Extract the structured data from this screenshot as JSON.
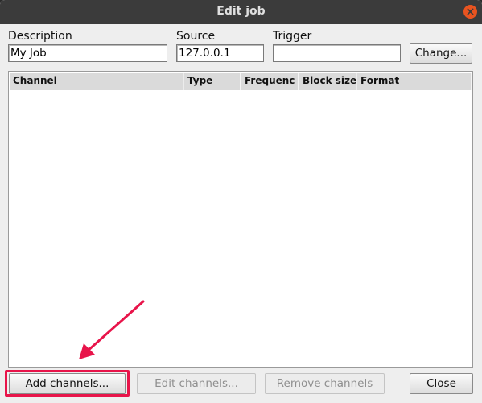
{
  "window": {
    "title": "Edit job"
  },
  "fields": {
    "description": {
      "label": "Description",
      "value": "My Job"
    },
    "source": {
      "label": "Source",
      "value": "127.0.0.1"
    },
    "trigger": {
      "label": "Trigger",
      "value": ""
    }
  },
  "buttons": {
    "change": "Change...",
    "add_channels": "Add channels...",
    "edit_channels": "Edit channels...",
    "remove_channels": "Remove channels",
    "close": "Close"
  },
  "table": {
    "columns": [
      "Channel",
      "Type",
      "Frequenc",
      "Block size",
      "Format"
    ]
  },
  "annotation": {
    "highlight_color": "#e8144a"
  }
}
